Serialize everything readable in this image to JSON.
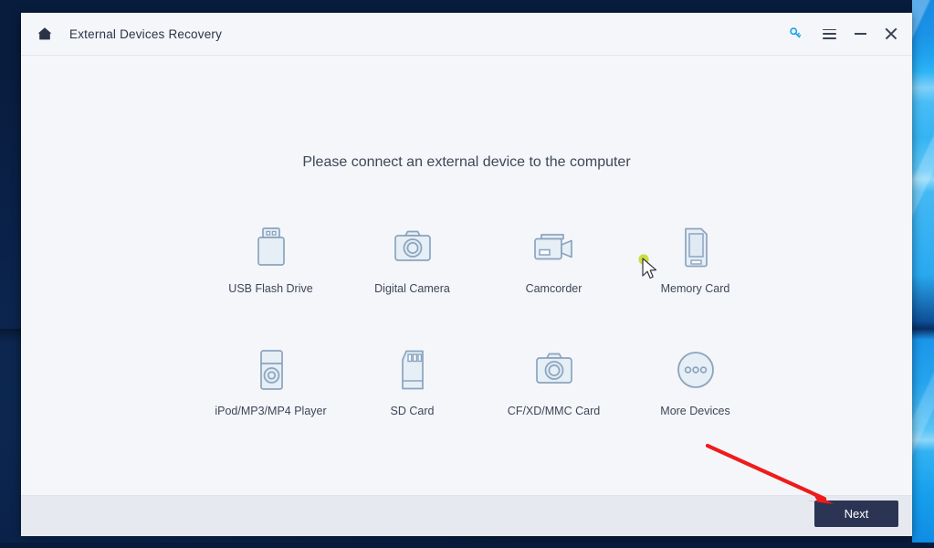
{
  "window": {
    "title": "External Devices Recovery",
    "home_icon": "home-icon",
    "controls": {
      "key_label": "key-icon",
      "menu_label": "hamburger-menu-icon",
      "minimize_label": "minimize-icon",
      "close_label": "close-icon"
    },
    "accent_key_color": "#1aa0e6",
    "next_button_color": "#2b3553",
    "background": "#f4f6fa",
    "footer_background": "#e6eaf0"
  },
  "main": {
    "prompt": "Please connect an external device to the computer",
    "devices": [
      {
        "label": "USB Flash Drive",
        "icon": "usb-flash-drive-icon"
      },
      {
        "label": "Digital Camera",
        "icon": "digital-camera-icon"
      },
      {
        "label": "Camcorder",
        "icon": "camcorder-icon"
      },
      {
        "label": "Memory Card",
        "icon": "memory-card-icon"
      },
      {
        "label": "iPod/MP3/MP4 Player",
        "icon": "ipod-player-icon"
      },
      {
        "label": "SD Card",
        "icon": "sd-card-icon"
      },
      {
        "label": "CF/XD/MMC Card",
        "icon": "cf-xd-mmc-card-icon"
      },
      {
        "label": "More Devices",
        "icon": "more-devices-icon"
      }
    ],
    "device_icon_fill": "#e6eef6",
    "device_icon_stroke": "#8ba4bd"
  },
  "footer": {
    "next_label": "Next"
  },
  "annotation": {
    "arrow_color": "#ef1b1b",
    "arrow_name": "red-pointer-arrow"
  },
  "cursor": {
    "highlight_color": "#cada2c"
  }
}
